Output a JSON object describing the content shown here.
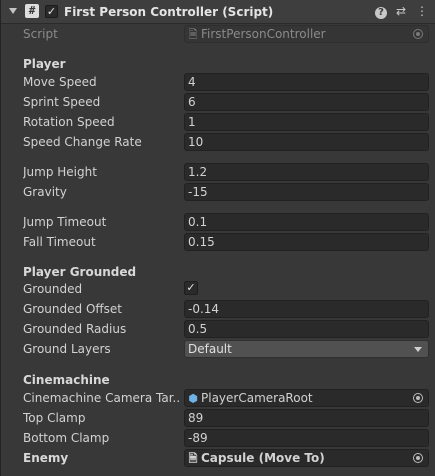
{
  "component": {
    "title": "First Person Controller (Script)",
    "enabled_mark": "✓",
    "script_icon_glyph": "#",
    "help_icon_glyph": "?",
    "presets_icon_glyph": "⇄",
    "menu_icon_glyph": "⋮"
  },
  "script_row": {
    "label": "Script",
    "value": "FirstPersonController"
  },
  "sections": {
    "player": "Player",
    "grounded": "Player Grounded",
    "cinemachine": "Cinemachine"
  },
  "player": {
    "move_speed": {
      "label": "Move Speed",
      "value": "4"
    },
    "sprint_speed": {
      "label": "Sprint Speed",
      "value": "6"
    },
    "rotation_speed": {
      "label": "Rotation Speed",
      "value": "1"
    },
    "speed_change_rate": {
      "label": "Speed Change Rate",
      "value": "10"
    },
    "jump_height": {
      "label": "Jump Height",
      "value": "1.2"
    },
    "gravity": {
      "label": "Gravity",
      "value": "-15"
    },
    "jump_timeout": {
      "label": "Jump Timeout",
      "value": "0.1"
    },
    "fall_timeout": {
      "label": "Fall Timeout",
      "value": "0.15"
    }
  },
  "grounded": {
    "grounded": {
      "label": "Grounded",
      "checked_mark": "✓"
    },
    "grounded_offset": {
      "label": "Grounded Offset",
      "value": "-0.14"
    },
    "grounded_radius": {
      "label": "Grounded Radius",
      "value": "0.5"
    },
    "ground_layers": {
      "label": "Ground Layers",
      "value": "Default"
    }
  },
  "cinemachine": {
    "camera_target": {
      "label": "Cinemachine Camera Tar...",
      "value": "PlayerCameraRoot"
    },
    "top_clamp": {
      "label": "Top Clamp",
      "value": "89"
    },
    "bottom_clamp": {
      "label": "Bottom Clamp",
      "value": "-89"
    }
  },
  "enemy": {
    "label": "Enemy",
    "value": "Capsule (Move To)"
  },
  "icons": {
    "game_object_icon": "cube-icon",
    "script_asset_icon": "script-file-icon",
    "object_picker_icon": "object-picker-icon"
  }
}
